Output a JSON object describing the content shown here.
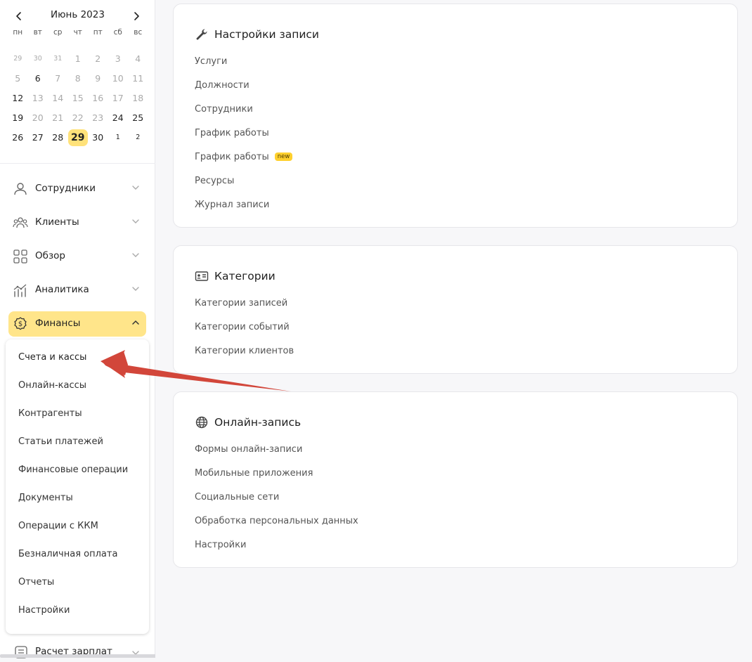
{
  "calendar": {
    "title": "Июнь 2023",
    "weekdays": [
      "пн",
      "вт",
      "ср",
      "чт",
      "пт",
      "сб",
      "вс"
    ],
    "weeks": [
      [
        "29",
        "30",
        "31",
        "1",
        "2",
        "3",
        "4"
      ],
      [
        "5",
        "6",
        "7",
        "8",
        "9",
        "10",
        "11"
      ],
      [
        "12",
        "13",
        "14",
        "15",
        "16",
        "17",
        "18"
      ],
      [
        "19",
        "20",
        "21",
        "22",
        "23",
        "24",
        "25"
      ],
      [
        "26",
        "27",
        "28",
        "29",
        "30",
        "1",
        "2"
      ]
    ],
    "today": "29"
  },
  "nav": {
    "items": [
      {
        "label": "Сотрудники",
        "icon": "user-icon"
      },
      {
        "label": "Клиенты",
        "icon": "users-icon"
      },
      {
        "label": "Обзор",
        "icon": "grid-icon"
      },
      {
        "label": "Аналитика",
        "icon": "analytics-icon"
      },
      {
        "label": "Финансы",
        "icon": "dollar-icon"
      }
    ],
    "finance_sub": [
      "Счета и кассы",
      "Онлайн-кассы",
      "Контрагенты",
      "Статьи платежей",
      "Финансовые операции",
      "Документы",
      "Операции с ККМ",
      "Безналичная оплата",
      "Отчеты",
      "Настройки"
    ],
    "bottom_label": "Расчет зарплат"
  },
  "cards": [
    {
      "title": "Настройки записи",
      "icon": "wrench-icon",
      "links": [
        "Услуги",
        "Должности",
        "Сотрудники",
        "График работы",
        "График работы",
        "Ресурсы",
        "Журнал записи"
      ],
      "badge": "new"
    },
    {
      "title": "Категории",
      "icon": "id-card-icon",
      "links": [
        "Категории записей",
        "Категории событий",
        "Категории клиентов"
      ]
    },
    {
      "title": "Онлайн-запись",
      "icon": "globe-icon",
      "links": [
        "Формы онлайн-записи",
        "Мобильные приложения",
        "Социальные сети",
        "Обработка персональных данных",
        "Настройки"
      ]
    }
  ],
  "colors": {
    "accent": "#ffe58a",
    "today": "#ffe27a",
    "badge": "#ffd02e",
    "arrow": "#d2463a"
  }
}
